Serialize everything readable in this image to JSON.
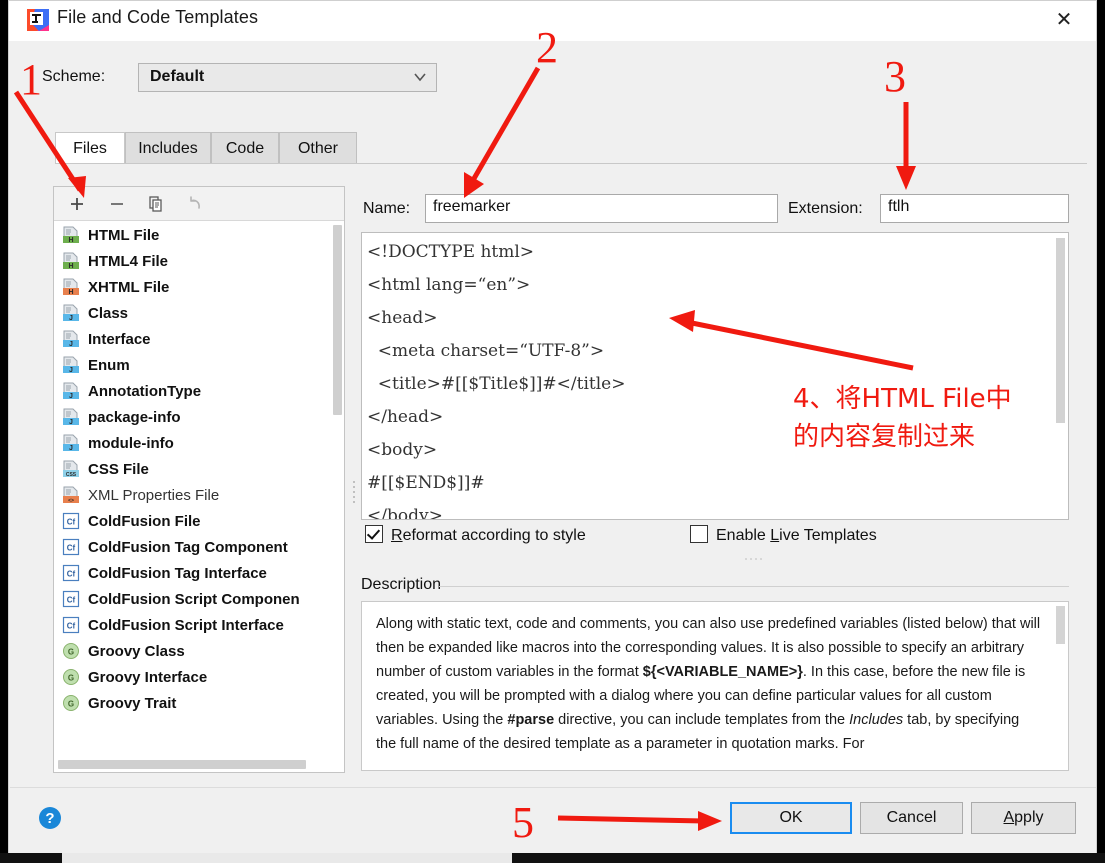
{
  "window": {
    "title": "File and Code Templates",
    "app_icon": "intellij-idea-icon",
    "close_label": "✕"
  },
  "scheme": {
    "label": "Scheme:",
    "value": "Default",
    "chevron": "chevron-down-icon"
  },
  "tabs": [
    {
      "label": "Files",
      "active": true
    },
    {
      "label": "Includes",
      "active": false
    },
    {
      "label": "Code",
      "active": false
    },
    {
      "label": "Other",
      "active": false
    }
  ],
  "list_toolbar": [
    {
      "name": "add-template-button",
      "glyph": "+"
    },
    {
      "name": "remove-template-button",
      "glyph": "−"
    },
    {
      "name": "copy-template-button",
      "glyph": "copy-icon"
    },
    {
      "name": "reset-template-button",
      "glyph": "undo-icon"
    }
  ],
  "file_list": [
    {
      "label": "HTML File",
      "icon": "html-file-icon",
      "badge": "H",
      "badge_color": "#6eaf4e",
      "dim": false
    },
    {
      "label": "HTML4 File",
      "icon": "html-file-icon",
      "badge": "H",
      "badge_color": "#6eaf4e",
      "dim": false
    },
    {
      "label": "XHTML File",
      "icon": "xhtml-file-icon",
      "badge": "H",
      "badge_color": "#e8804d",
      "dim": false
    },
    {
      "label": "Class",
      "icon": "java-class-icon",
      "badge": "J",
      "badge_color": "#59b7e8",
      "dim": false
    },
    {
      "label": "Interface",
      "icon": "java-interface-icon",
      "badge": "J",
      "badge_color": "#59b7e8",
      "dim": false
    },
    {
      "label": "Enum",
      "icon": "java-enum-icon",
      "badge": "J",
      "badge_color": "#59b7e8",
      "dim": false
    },
    {
      "label": "AnnotationType",
      "icon": "java-annotation-icon",
      "badge": "J",
      "badge_color": "#59b7e8",
      "dim": false
    },
    {
      "label": "package-info",
      "icon": "java-package-info-icon",
      "badge": "J",
      "badge_color": "#59b7e8",
      "dim": false
    },
    {
      "label": "module-info",
      "icon": "java-module-info-icon",
      "badge": "J",
      "badge_color": "#59b7e8",
      "dim": false
    },
    {
      "label": "CSS File",
      "icon": "css-file-icon",
      "badge": "CSS",
      "badge_color": "#8ed0e8",
      "dim": false
    },
    {
      "label": "XML Properties File",
      "icon": "xml-properties-file-icon",
      "badge": "<>",
      "badge_color": "#e8804d",
      "dim": true
    },
    {
      "label": "ColdFusion File",
      "icon": "coldfusion-file-icon",
      "badge": "Cf",
      "badge_color": "#ffffff",
      "dim": false
    },
    {
      "label": "ColdFusion Tag Component",
      "icon": "coldfusion-file-icon",
      "badge": "Cf",
      "badge_color": "#ffffff",
      "dim": false
    },
    {
      "label": "ColdFusion Tag Interface",
      "icon": "coldfusion-file-icon",
      "badge": "Cf",
      "badge_color": "#ffffff",
      "dim": false
    },
    {
      "label": "ColdFusion Script Componen",
      "icon": "coldfusion-file-icon",
      "badge": "Cf",
      "badge_color": "#ffffff",
      "dim": false
    },
    {
      "label": "ColdFusion Script Interface",
      "icon": "coldfusion-file-icon",
      "badge": "Cf",
      "badge_color": "#ffffff",
      "dim": false
    },
    {
      "label": "Groovy Class",
      "icon": "groovy-file-icon",
      "badge": "G",
      "badge_color": "#bfdfae",
      "dim": false
    },
    {
      "label": "Groovy Interface",
      "icon": "groovy-file-icon",
      "badge": "G",
      "badge_color": "#bfdfae",
      "dim": false
    },
    {
      "label": "Groovy Trait",
      "icon": "groovy-file-icon",
      "badge": "G",
      "badge_color": "#bfdfae",
      "dim": false
    }
  ],
  "fields": {
    "name_label": "Name:",
    "name_value": "freemarker",
    "extension_label": "Extension:",
    "extension_value": "ftlh"
  },
  "editor": {
    "content": "<!DOCTYPE html>\n<html lang=“en”>\n<head>\n  <meta charset=“UTF-8”>\n  <title>#[[$Title$]]#</title>\n</head>\n<body>\n#[[$END$]]#\n</body>"
  },
  "options": {
    "reformat_label": "Reformat according to style",
    "reformat_checked": true,
    "live_templates_label": "Enable Live Templates",
    "live_templates_checked": false
  },
  "description": {
    "section_label": "Description",
    "paragraph_1": "Along with static text, code and comments, you can also use predefined variables (listed below) that will then be expanded like macros into the corresponding values. It is also possible to specify an arbitrary number of custom variables in the format ",
    "variable_token": "${<VARIABLE_NAME>}",
    "paragraph_2": ". In this case, before the new file is created, you will be prompted with a dialog where you can define particular values for all custom variables. Using the ",
    "parse_token": "#parse",
    "paragraph_3": " directive, you can include templates from the ",
    "includes_token": "Includes",
    "paragraph_4": " tab, by specifying the full name of the desired template as a parameter in quotation marks. For"
  },
  "footer": {
    "help_glyph": "?",
    "ok_label": "OK",
    "cancel_label": "Cancel",
    "apply_label": "Apply"
  },
  "annotations": {
    "n1": "1",
    "n2": "2",
    "n3": "3",
    "n4_text": "4、将HTML File中的内容复制过来",
    "n5": "5",
    "color": "#f01a10"
  }
}
